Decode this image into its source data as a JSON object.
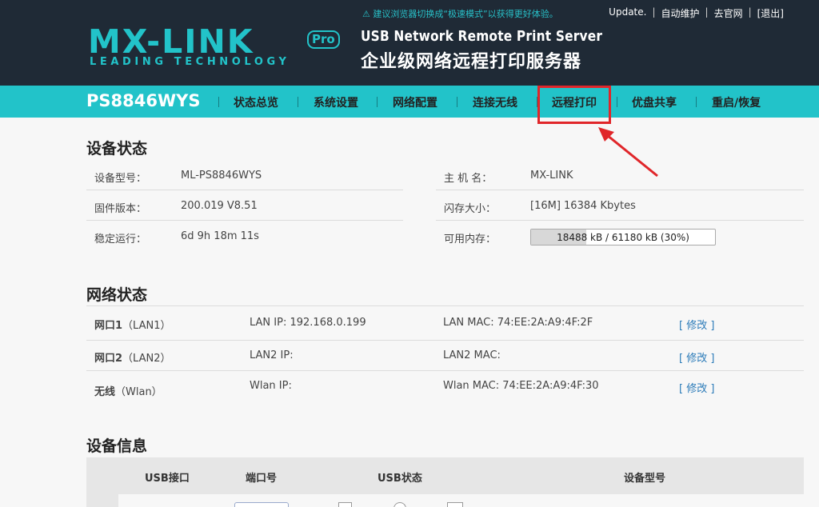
{
  "header": {
    "logo_main": "MX-LINK",
    "logo_pro": "Pro",
    "logo_sub": "LEADING TECHNOLOGY",
    "title_en": "USB Network Remote Print Server",
    "title_cn": "企业级网络远程打印服务器",
    "tip": "⚠ 建议浏览器切换成“极速模式”以获得更好体验。",
    "links": [
      "Update.",
      "自动维护",
      "去官网",
      "[退出]"
    ]
  },
  "nav": {
    "brand": "PS8846WYS",
    "items": [
      "状态总览",
      "系统设置",
      "网络配置",
      "连接无线",
      "远程打印",
      "优盘共享",
      "重启/恢复"
    ]
  },
  "device_status": {
    "title": "设备状态",
    "rows": [
      {
        "label": "设备型号：",
        "value": "ML-PS8846WYS"
      },
      {
        "label": "固件版本：",
        "value": "200.019 V8.51"
      },
      {
        "label": "稳定运行：",
        "value": "6d 9h 18m 11s"
      }
    ],
    "rows_right": [
      {
        "label": "主 机 名：",
        "value": "MX-LINK"
      },
      {
        "label": "闪存大小：",
        "value": "[16M] 16384 Kbytes"
      },
      {
        "label": "可用内存：",
        "value": "18488 kB / 61180 kB (30%)"
      }
    ],
    "memory_percent": 30
  },
  "network_status": {
    "title": "网络状态",
    "rows": [
      {
        "port": "网口1",
        "port_sub": "（LAN1）",
        "ip": "LAN IP: 192.168.0.199",
        "mac": "LAN MAC: 74:EE:2A:A9:4F:2F",
        "action": "[ 修改 ]"
      },
      {
        "port": "网口2",
        "port_sub": "（LAN2）",
        "ip": "LAN2 IP:",
        "mac": "LAN2 MAC:",
        "action": "[ 修改 ]"
      },
      {
        "port": "无线",
        "port_sub": "（Wlan）",
        "ip": "Wlan IP:",
        "mac": "Wlan MAC: 74:EE:2A:A9:4F:30",
        "action": "[ 修改 ]"
      }
    ]
  },
  "device_info": {
    "title": "设备信息",
    "columns": [
      "USB接口",
      "端口号",
      "USB状态",
      "设备型号"
    ]
  },
  "colors": {
    "header_bg": "#1f2a36",
    "accent": "#22c3c9",
    "highlight": "#e0262a"
  }
}
